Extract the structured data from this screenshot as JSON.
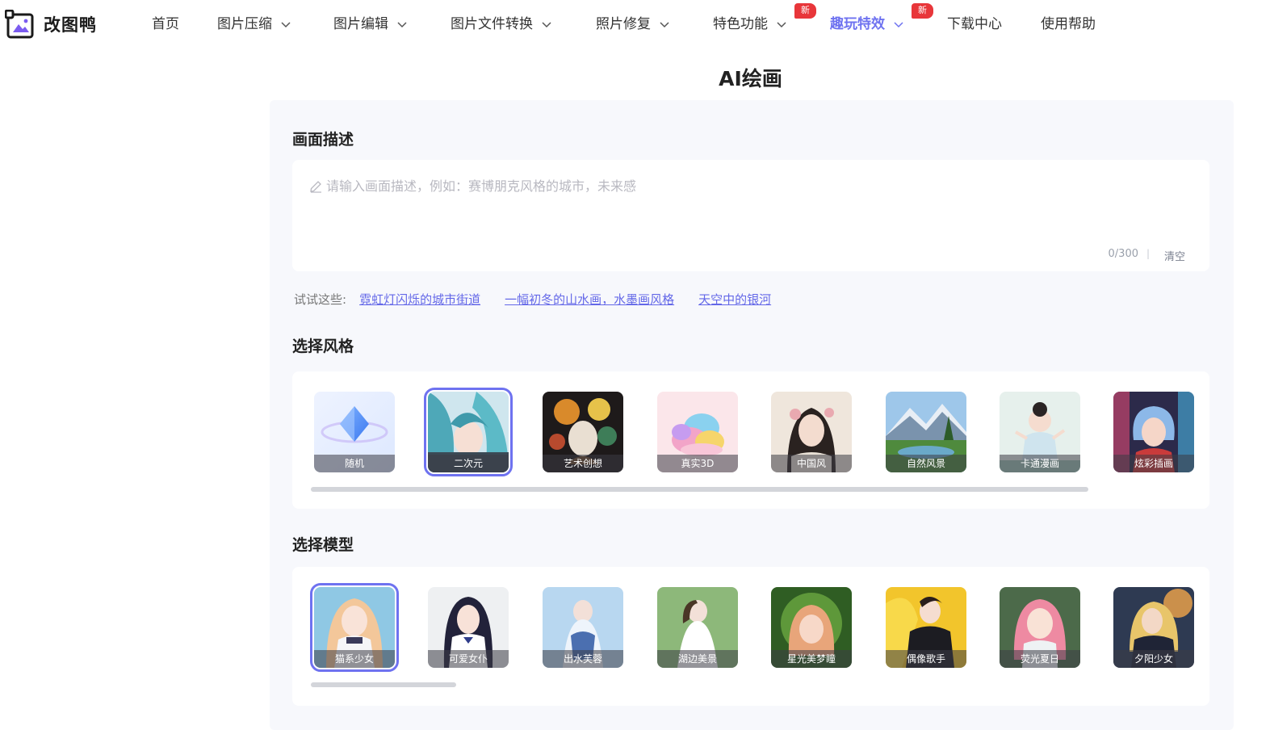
{
  "brand": {
    "name": "改图鸭",
    "accent": "#6e72f0",
    "badge_color": "#e8363a"
  },
  "nav": {
    "items": [
      {
        "label": "首页",
        "dropdown": false
      },
      {
        "label": "图片压缩",
        "dropdown": true
      },
      {
        "label": "图片编辑",
        "dropdown": true
      },
      {
        "label": "图片文件转换",
        "dropdown": true
      },
      {
        "label": "照片修复",
        "dropdown": true
      },
      {
        "label": "特色功能",
        "dropdown": true,
        "badge": "新"
      },
      {
        "label": "趣玩特效",
        "dropdown": true,
        "badge": "新",
        "active": true
      },
      {
        "label": "下载中心",
        "dropdown": false
      },
      {
        "label": "使用帮助",
        "dropdown": false
      }
    ]
  },
  "page": {
    "title": "AI绘画"
  },
  "description": {
    "title": "画面描述",
    "placeholder": "请输入画面描述，例如：赛博朋克风格的城市，未来感",
    "value": "",
    "counter": "0/300",
    "separator": "|",
    "clear_label": "清空"
  },
  "suggestions": {
    "label": "试试这些:",
    "items": [
      "霓虹灯闪烁的城市街道",
      "一幅初冬的山水画，水墨画风格",
      "天空中的银河"
    ]
  },
  "styles": {
    "title": "选择风格",
    "selected_index": 1,
    "items": [
      {
        "label": "随机",
        "icon": "diamond-icon"
      },
      {
        "label": "二次元"
      },
      {
        "label": "艺术创想"
      },
      {
        "label": "真实3D"
      },
      {
        "label": "中国风"
      },
      {
        "label": "自然风景"
      },
      {
        "label": "卡通漫画"
      },
      {
        "label": "炫彩插画"
      }
    ]
  },
  "models": {
    "title": "选择模型",
    "selected_index": 0,
    "items": [
      {
        "label": "猫系少女"
      },
      {
        "label": "可爱女仆"
      },
      {
        "label": "出水芙蓉"
      },
      {
        "label": "湖边美景"
      },
      {
        "label": "星光美梦瞳"
      },
      {
        "label": "偶像歌手"
      },
      {
        "label": "荧光夏日"
      },
      {
        "label": "夕阳少女"
      }
    ]
  }
}
